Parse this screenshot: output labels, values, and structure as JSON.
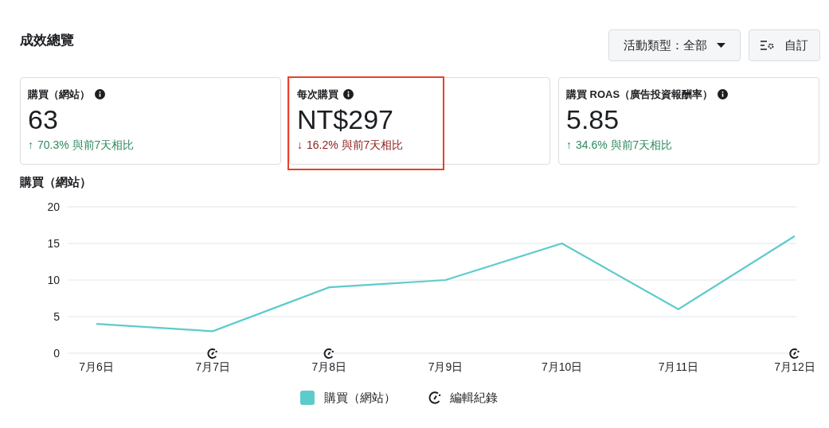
{
  "header": {
    "title": "成效總覽",
    "filter_button": "活動類型：全部",
    "customize_button": "自訂"
  },
  "cards": [
    {
      "label": "購買（網站）",
      "value": "63",
      "arrow": "↑",
      "color": "#2f8a5f",
      "change": "70.3% 與前7天相比",
      "highlighted": false
    },
    {
      "label": "每次購買",
      "value": "NT$297",
      "arrow": "↓",
      "color": "#8b1c1c",
      "change": "16.2% 與前7天相比",
      "highlighted": true
    },
    {
      "label": "購買 ROAS（廣告投資報酬率）",
      "value": "5.85",
      "arrow": "↑",
      "color": "#2f8a5f",
      "change": "34.6% 與前7天相比",
      "highlighted": false
    }
  ],
  "chart": {
    "title": "購買（網站）",
    "chart_data": {
      "type": "line",
      "categories": [
        "7月6日",
        "7月7日",
        "7月8日",
        "7月9日",
        "7月10日",
        "7月11日",
        "7月12日"
      ],
      "series": [
        {
          "name": "購買（網站）",
          "color": "#5ecbcb",
          "values": [
            4,
            3,
            9,
            10,
            15,
            6,
            16
          ]
        }
      ],
      "ylim": [
        0,
        20
      ],
      "yticks": [
        0,
        5,
        10,
        15,
        20
      ],
      "grid": true
    },
    "edit_markers": [
      {
        "edited": false
      },
      {
        "edited": true
      },
      {
        "edited": true
      },
      {
        "edited": false
      },
      {
        "edited": false
      },
      {
        "edited": false
      },
      {
        "edited": true
      }
    ],
    "legend_edit": "編輯紀錄"
  }
}
